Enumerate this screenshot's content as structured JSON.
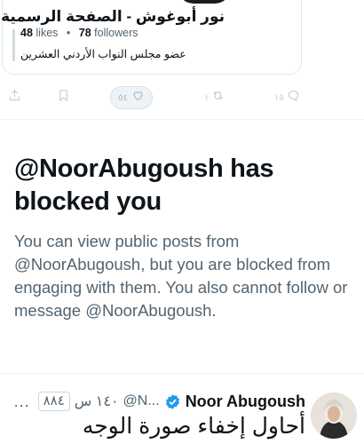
{
  "embedded_card": {
    "title": "نور أبوغوش - الصفحة الرسمية",
    "likes_count": "48",
    "likes_label": "likes",
    "followers_count": "78",
    "followers_label": "followers",
    "bio": "عضو مجلس النواب الأردني العشرين"
  },
  "actions": {
    "like_count": "٥٤",
    "retweet_count": "١",
    "reply_count": "١٥"
  },
  "blocked": {
    "title": "@NoorAbugoush has blocked you",
    "body": "You can view public posts from @NoorAbugoush, but you are blocked from engaging with them. You also cannot follow or message @NoorAbugoush."
  },
  "tweet": {
    "name": "Noor Abugoush",
    "handle": "@N...",
    "time": "١٤٠ س",
    "views_badge": "٨٨٤",
    "more": "...",
    "text": "أحاول إخفاء صورة الوجه"
  },
  "colors": {
    "text": "#0f1419",
    "muted": "#536471",
    "verified": "#1d9bf0",
    "divider": "#eff3f4"
  }
}
